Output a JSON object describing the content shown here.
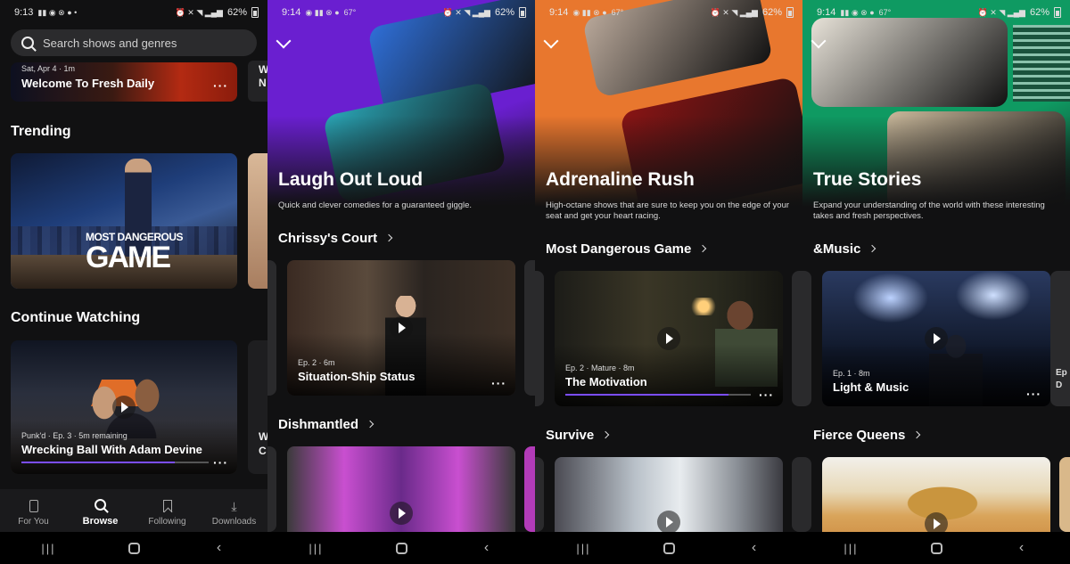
{
  "status_bars": [
    {
      "time": "9:13",
      "battery": "62%"
    },
    {
      "time": "9:14",
      "battery": "62%",
      "temp": "67°"
    },
    {
      "time": "9:14",
      "battery": "62%",
      "temp": "67°"
    },
    {
      "time": "9:14",
      "battery": "62%",
      "temp": "67°"
    }
  ],
  "browse": {
    "search_placeholder": "Search shows and genres",
    "hero": {
      "meta": "Sat, Apr 4 · 1m",
      "title": "Welcome To Fresh Daily"
    },
    "peek_hero_text": "W N",
    "trending_title": "Trending",
    "trending_logo_top": "MOST DANGEROUS",
    "trending_logo_bottom": "GAME",
    "continue_title": "Continue Watching",
    "continue_card": {
      "meta": "Punk'd · Ep. 3 · 5m remaining",
      "title": "Wrecking Ball With Adam Devine",
      "progress": 0.82
    },
    "peek_cw_text": "W C",
    "tabs": [
      {
        "label": "For You",
        "icon": "phone-icon"
      },
      {
        "label": "Browse",
        "icon": "search-icon"
      },
      {
        "label": "Following",
        "icon": "bookmark-icon"
      },
      {
        "label": "Downloads",
        "icon": "download-icon"
      }
    ]
  },
  "categories": [
    {
      "title": "Laugh Out Loud",
      "description": "Quick and clever comedies for a guaranteed giggle.",
      "rows": [
        {
          "title": "Chrissy's Court",
          "card": {
            "meta": "Ep. 2 · 6m",
            "title": "Situation-Ship Status",
            "progress": 0
          }
        },
        {
          "title": "Dishmantled"
        }
      ],
      "colors": {
        "hero": "#6a1fd0",
        "tile1": "#2f6fd8",
        "tile2": "#2aa7b8"
      }
    },
    {
      "title": "Adrenaline Rush",
      "description": "High-octane shows that are sure to keep you on the edge of your seat and get your heart racing.",
      "rows": [
        {
          "title": "Most Dangerous Game",
          "card": {
            "meta": "Ep. 2 · Mature · 8m",
            "title": "The Motivation",
            "progress": 0.88
          }
        },
        {
          "title": "Survive"
        }
      ],
      "colors": {
        "hero": "#e8772e",
        "tile1": "#b9a89a",
        "tile2": "#8a1414"
      }
    },
    {
      "title": "True Stories",
      "description": "Expand your understanding of the world with these interesting takes and fresh perspectives.",
      "rows": [
        {
          "title": "&Music",
          "card": {
            "meta": "Ep. 1 · 8m",
            "title": "Light & Music",
            "progress": 0
          }
        },
        {
          "title": "Fierce Queens"
        }
      ],
      "peek_text": "Ep D",
      "colors": {
        "hero": "#0f9a62",
        "tile1": "#e7e2d8",
        "tile2": "#c8b79a"
      }
    }
  ]
}
